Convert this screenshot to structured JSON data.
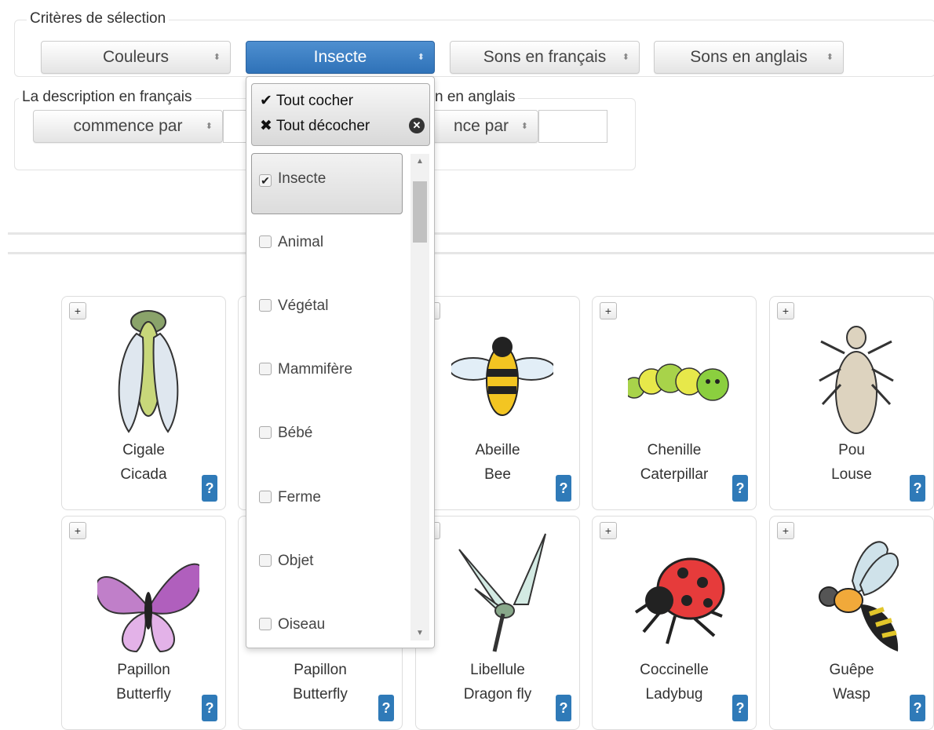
{
  "criteria": {
    "legend": "Critères de sélection",
    "selects": [
      "Couleurs",
      "Insecte",
      "Sons en français",
      "Sons en anglais"
    ]
  },
  "desc_fr": {
    "legend": "La description en français",
    "select": "commence par"
  },
  "desc_en": {
    "legend": "n en anglais",
    "select": "nce par"
  },
  "dropdown": {
    "check_all": "Tout cocher",
    "uncheck_all": "Tout décocher",
    "options": [
      {
        "label": "Insecte",
        "checked": true
      },
      {
        "label": "Animal",
        "checked": false
      },
      {
        "label": "Végétal",
        "checked": false
      },
      {
        "label": "Mammifère",
        "checked": false
      },
      {
        "label": "Bébé",
        "checked": false
      },
      {
        "label": "Ferme",
        "checked": false
      },
      {
        "label": "Objet",
        "checked": false
      },
      {
        "label": "Oiseau",
        "checked": false
      }
    ]
  },
  "cards": [
    {
      "fr": "Cigale",
      "en": "Cicada"
    },
    {
      "fr": "",
      "en": ""
    },
    {
      "fr": "Abeille",
      "en": "Bee"
    },
    {
      "fr": "Chenille",
      "en": "Caterpillar"
    },
    {
      "fr": "Pou",
      "en": "Louse"
    },
    {
      "fr": "Papillon",
      "en": "Butterfly"
    },
    {
      "fr": "Papillon",
      "en": "Butterfly"
    },
    {
      "fr": "Libellule",
      "en": "Dragon fly"
    },
    {
      "fr": "Coccinelle",
      "en": "Ladybug"
    },
    {
      "fr": "Guêpe",
      "en": "Wasp"
    }
  ],
  "ui": {
    "plus": "+",
    "help": "?",
    "checkmark": "✔",
    "cross": "✖"
  },
  "colors": {
    "primary": "#2f72b8",
    "help": "#2f7ab8"
  }
}
